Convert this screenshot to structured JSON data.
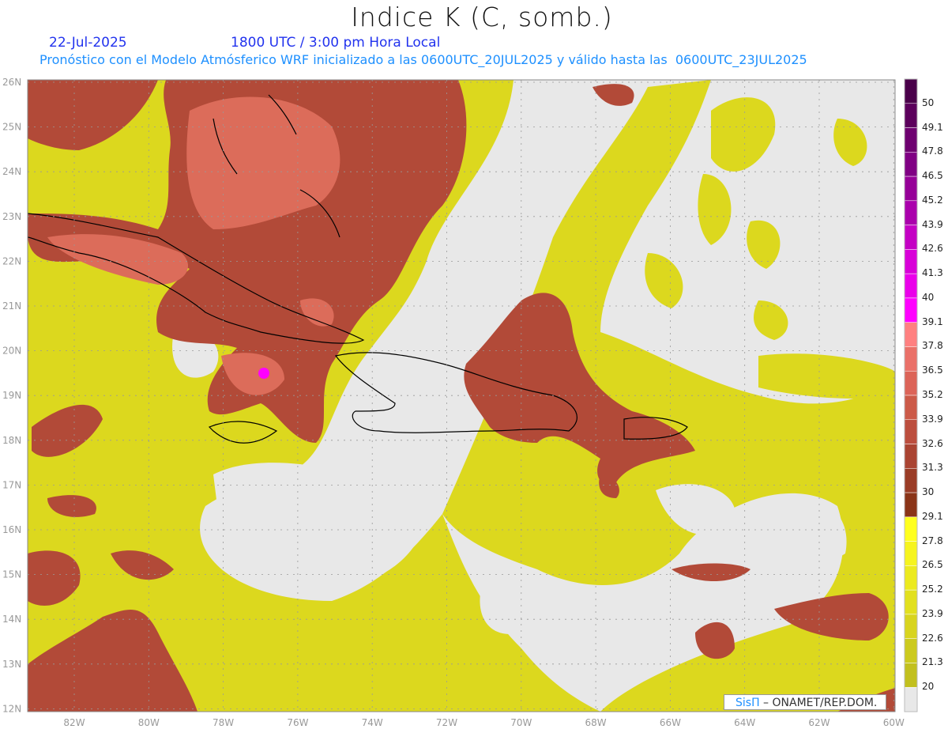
{
  "header": {
    "title": "Indice K (C, somb.)",
    "date": "22-Jul-2025",
    "time": "1800 UTC / 3:00 pm Hora Local",
    "description": "Pronóstico con el Modelo Atmósferico WRF inicializado a las 0600UTC_20JUL2025 y válido hasta las  0600UTC_23JUL2025"
  },
  "axes": {
    "lon_labels": [
      "82W",
      "80W",
      "78W",
      "76W",
      "74W",
      "72W",
      "70W",
      "68W",
      "66W",
      "64W",
      "62W",
      "60W"
    ],
    "lat_labels": [
      "26N",
      "25N",
      "24N",
      "23N",
      "22N",
      "21N",
      "20N",
      "19N",
      "18N",
      "17N",
      "16N",
      "15N",
      "14N",
      "13N",
      "12N"
    ]
  },
  "colorbar": {
    "labels": [
      "50",
      "49.1",
      "47.8",
      "46.5",
      "45.2",
      "43.9",
      "42.6",
      "41.3",
      "40",
      "39.1",
      "37.8",
      "36.5",
      "35.2",
      "33.9",
      "32.6",
      "31.3",
      "30",
      "29.1",
      "27.8",
      "26.5",
      "25.2",
      "23.9",
      "22.6",
      "21.3",
      "20"
    ],
    "colors": [
      "#5c005c",
      "#6e0070",
      "#800084",
      "#960098",
      "#aa00ac",
      "#c400c4",
      "#d800d8",
      "#ea00ea",
      "#ff00ff",
      "#ff8080",
      "#ea7068",
      "#dc6458",
      "#cc5a48",
      "#bc4e3e",
      "#aa4432",
      "#9a3c26",
      "#8a3418",
      "#ffff1e",
      "#f6f41e",
      "#ecea1e",
      "#e2e01e",
      "#d8d41e",
      "#ccca1e",
      "#c2c01e",
      "#e8e8e8"
    ]
  },
  "credit": {
    "logo": "SisΠ",
    "text": " –  ONAMET/REP.DOM."
  }
}
